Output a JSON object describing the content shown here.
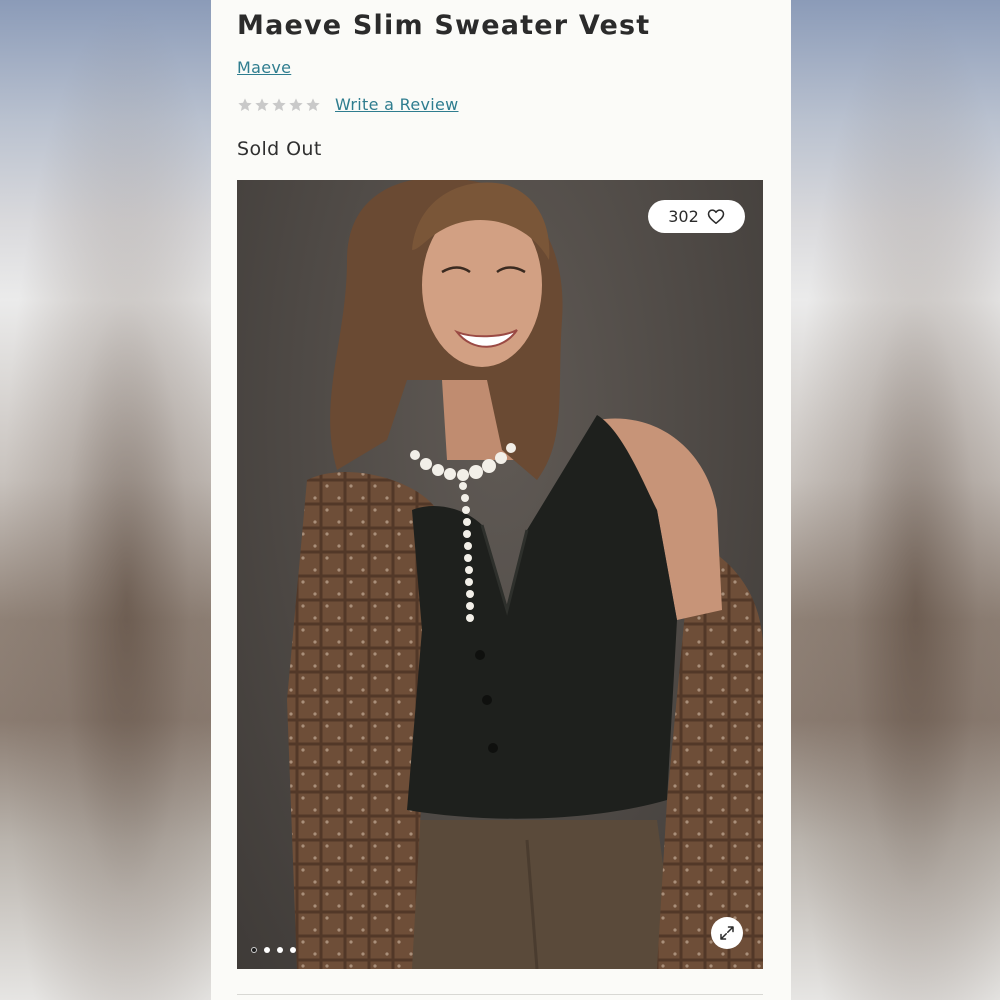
{
  "product": {
    "title": "Maeve Slim Sweater Vest",
    "brand": "Maeve",
    "rating_stars": 5,
    "rating_filled": 0,
    "review_link": "Write a Review",
    "stock_status": "Sold Out"
  },
  "gallery": {
    "favorites_count": "302",
    "active_slide": 1,
    "slide_count": 4,
    "favorite_icon": "heart-outline-icon",
    "expand_icon": "expand-icon"
  },
  "colors": {
    "link": "#2f7d8f",
    "star_empty": "#c9c9c9",
    "page_bg": "#fbfbf8"
  }
}
